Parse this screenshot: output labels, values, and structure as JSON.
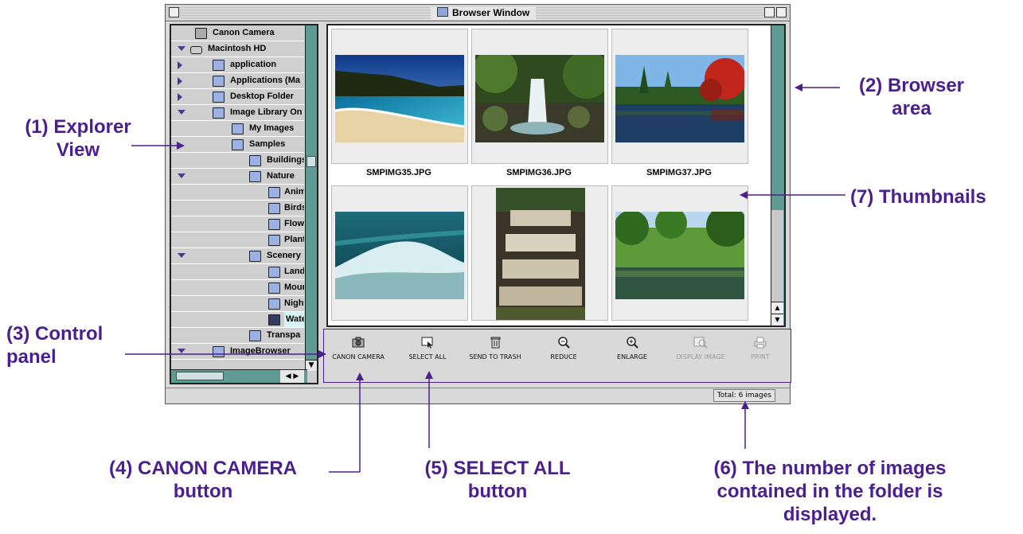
{
  "window": {
    "title": "Browser Window"
  },
  "explorer": {
    "items": [
      {
        "label": "Canon Camera",
        "icon": "camera-icon"
      },
      {
        "label": "Macintosh HD",
        "icon": "hard-drive-icon"
      },
      {
        "label": "application",
        "icon": "folder-icon"
      },
      {
        "label": "Applications (Ma",
        "icon": "folder-icon"
      },
      {
        "label": "Desktop Folder",
        "icon": "folder-icon"
      },
      {
        "label": "Image Library On",
        "icon": "folder-icon"
      },
      {
        "label": "My Images",
        "icon": "folder-icon"
      },
      {
        "label": "Samples",
        "icon": "folder-icon"
      },
      {
        "label": "Buildings",
        "icon": "folder-icon"
      },
      {
        "label": "Nature",
        "icon": "folder-icon"
      },
      {
        "label": "Anim",
        "icon": "folder-icon"
      },
      {
        "label": "Birds",
        "icon": "folder-icon"
      },
      {
        "label": "Flow",
        "icon": "folder-icon"
      },
      {
        "label": "Plant",
        "icon": "folder-icon"
      },
      {
        "label": "Scenery",
        "icon": "folder-icon"
      },
      {
        "label": "Land",
        "icon": "folder-icon"
      },
      {
        "label": "Moun",
        "icon": "folder-icon"
      },
      {
        "label": "Night",
        "icon": "folder-icon"
      },
      {
        "label": "Wate",
        "icon": "folder-icon-selected"
      },
      {
        "label": "Transpa",
        "icon": "folder-icon"
      },
      {
        "label": "ImageBrowser",
        "icon": "folder-icon"
      }
    ]
  },
  "browser": {
    "thumbnails": [
      {
        "filename": "SMPIMG35.JPG",
        "subject": "beach"
      },
      {
        "filename": "SMPIMG36.JPG",
        "subject": "waterfall"
      },
      {
        "filename": "SMPIMG37.JPG",
        "subject": "lake"
      },
      {
        "filename": "",
        "subject": "wave"
      },
      {
        "filename": "",
        "subject": "cascade"
      },
      {
        "filename": "",
        "subject": "tropical"
      }
    ]
  },
  "control_panel": {
    "buttons": [
      {
        "label": "CANON CAMERA",
        "icon": "camera-icon",
        "enabled": true
      },
      {
        "label": "SELECT ALL",
        "icon": "select-all-icon",
        "enabled": true
      },
      {
        "label": "SEND TO TRASH",
        "icon": "trash-icon",
        "enabled": true
      },
      {
        "label": "REDUCE",
        "icon": "zoom-out-icon",
        "enabled": true
      },
      {
        "label": "ENLARGE",
        "icon": "zoom-in-icon",
        "enabled": true
      },
      {
        "label": "DISPLAY IMAGE",
        "icon": "display-image-icon",
        "enabled": false
      },
      {
        "label": "PRINT",
        "icon": "print-icon",
        "enabled": false
      }
    ]
  },
  "status": {
    "text": "Total: 6 images"
  },
  "callouts": {
    "explorer": "(1) Explorer View",
    "browser": "(2) Browser area",
    "control": "(3) Control panel",
    "camera": "(4) CANON CAMERA button",
    "selectall": "(5) SELECT ALL button",
    "count": "(6) The number of images contained in the folder is displayed.",
    "thumbs": "(7) Thumbnails"
  },
  "colors": {
    "callout": "#4b1f8c",
    "scroll": "#5f9a93",
    "folder": "#9db0e2"
  }
}
